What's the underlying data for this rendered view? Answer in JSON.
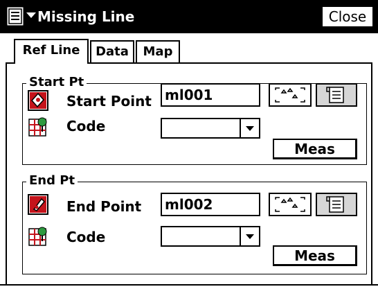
{
  "window": {
    "title": "Missing Line",
    "close_label": "Close"
  },
  "icons": {
    "menu": "menu-icon",
    "dropdown": "chevron-down-icon",
    "point": "point-icon",
    "code": "code-icon",
    "select_points": "select-points-icon",
    "point_list": "point-list-icon"
  },
  "tabs": [
    {
      "label": "Ref Line",
      "active": true
    },
    {
      "label": "Data",
      "active": false
    },
    {
      "label": "Map",
      "active": false
    }
  ],
  "start": {
    "group_label": "Start Pt",
    "point_label": "Start Point",
    "point_value": "ml001",
    "code_label": "Code",
    "code_value": "",
    "meas_label": "Meas"
  },
  "end": {
    "group_label": "End Pt",
    "point_label": "End Point",
    "point_value": "ml002",
    "code_label": "Code",
    "code_value": "",
    "meas_label": "Meas"
  },
  "colors": {
    "titlebar": "#000000",
    "background": "#ffffff",
    "pressed_button": "#d6d6d6",
    "point_icon": "#c4131b"
  }
}
